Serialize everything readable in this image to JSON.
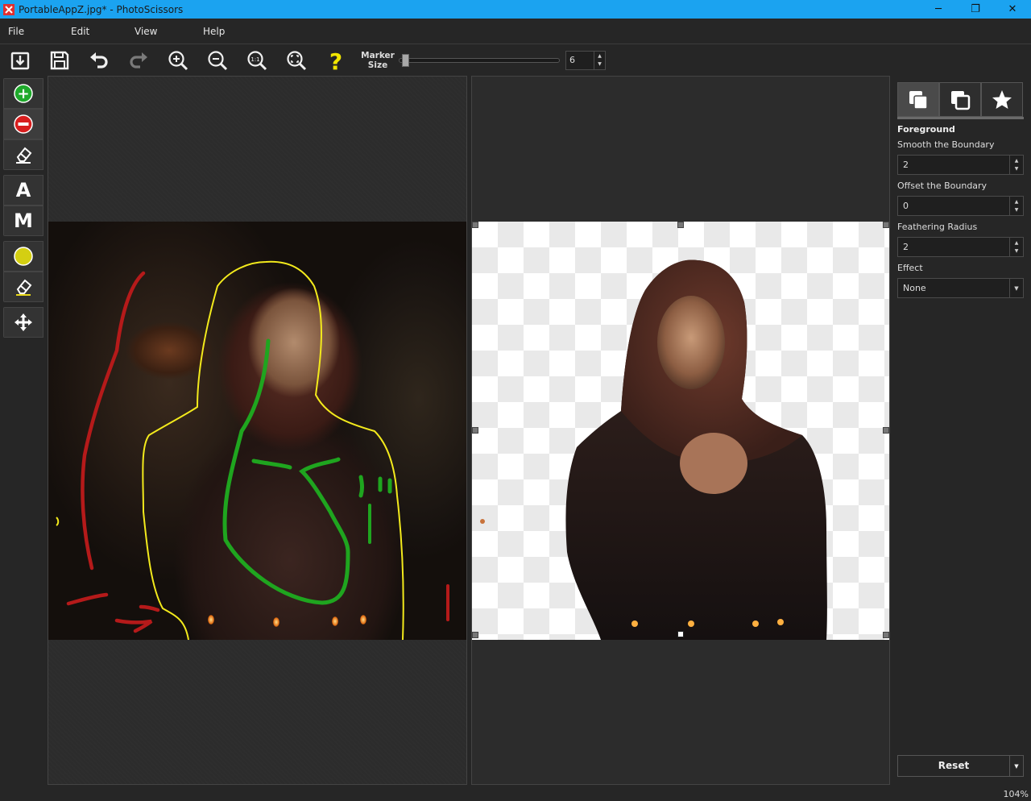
{
  "window": {
    "title": "PortableAppZ.jpg* - PhotoScissors",
    "minimize": "─",
    "restore": "❐",
    "close": "✕"
  },
  "menu": [
    "File",
    "Edit",
    "View",
    "Help"
  ],
  "toolbar": {
    "buttons": [
      "open-icon",
      "save-icon",
      "undo-icon",
      "redo-icon",
      "zoom-in-icon",
      "zoom-out-icon",
      "zoom-1to1-icon",
      "fit-icon",
      "help-icon"
    ],
    "zoom_1to1_text": "1:1",
    "help_glyph": "?",
    "marker_label_line1": "Marker",
    "marker_label_line2": "Size",
    "marker_size": "6",
    "marker_slider_fraction": 0.02
  },
  "left_tools": {
    "add_glyph": "+",
    "remove_glyph": "−",
    "text_tool": "A",
    "mark_tool": "M"
  },
  "colors": {
    "titlebar": "#1ba3f0",
    "foreground_marker": "#1fa51f",
    "background_marker": "#b51a1a",
    "boundary": "#f3ea1c",
    "help": "#f2e600"
  },
  "sidebar": {
    "tab_icons": [
      "foreground-icon",
      "background-icon",
      "effects-icon"
    ],
    "heading": "Foreground",
    "smooth_label": "Smooth the Boundary",
    "smooth_value": "2",
    "offset_label": "Offset the Boundary",
    "offset_value": "0",
    "feather_label": "Feathering Radius",
    "feather_value": "2",
    "effect_label": "Effect",
    "effect_value": "None",
    "reset_label": "Reset"
  },
  "spin_up": "▲",
  "spin_down": "▼",
  "dropdown_arrow": "▼",
  "status": {
    "zoom": "104%"
  }
}
